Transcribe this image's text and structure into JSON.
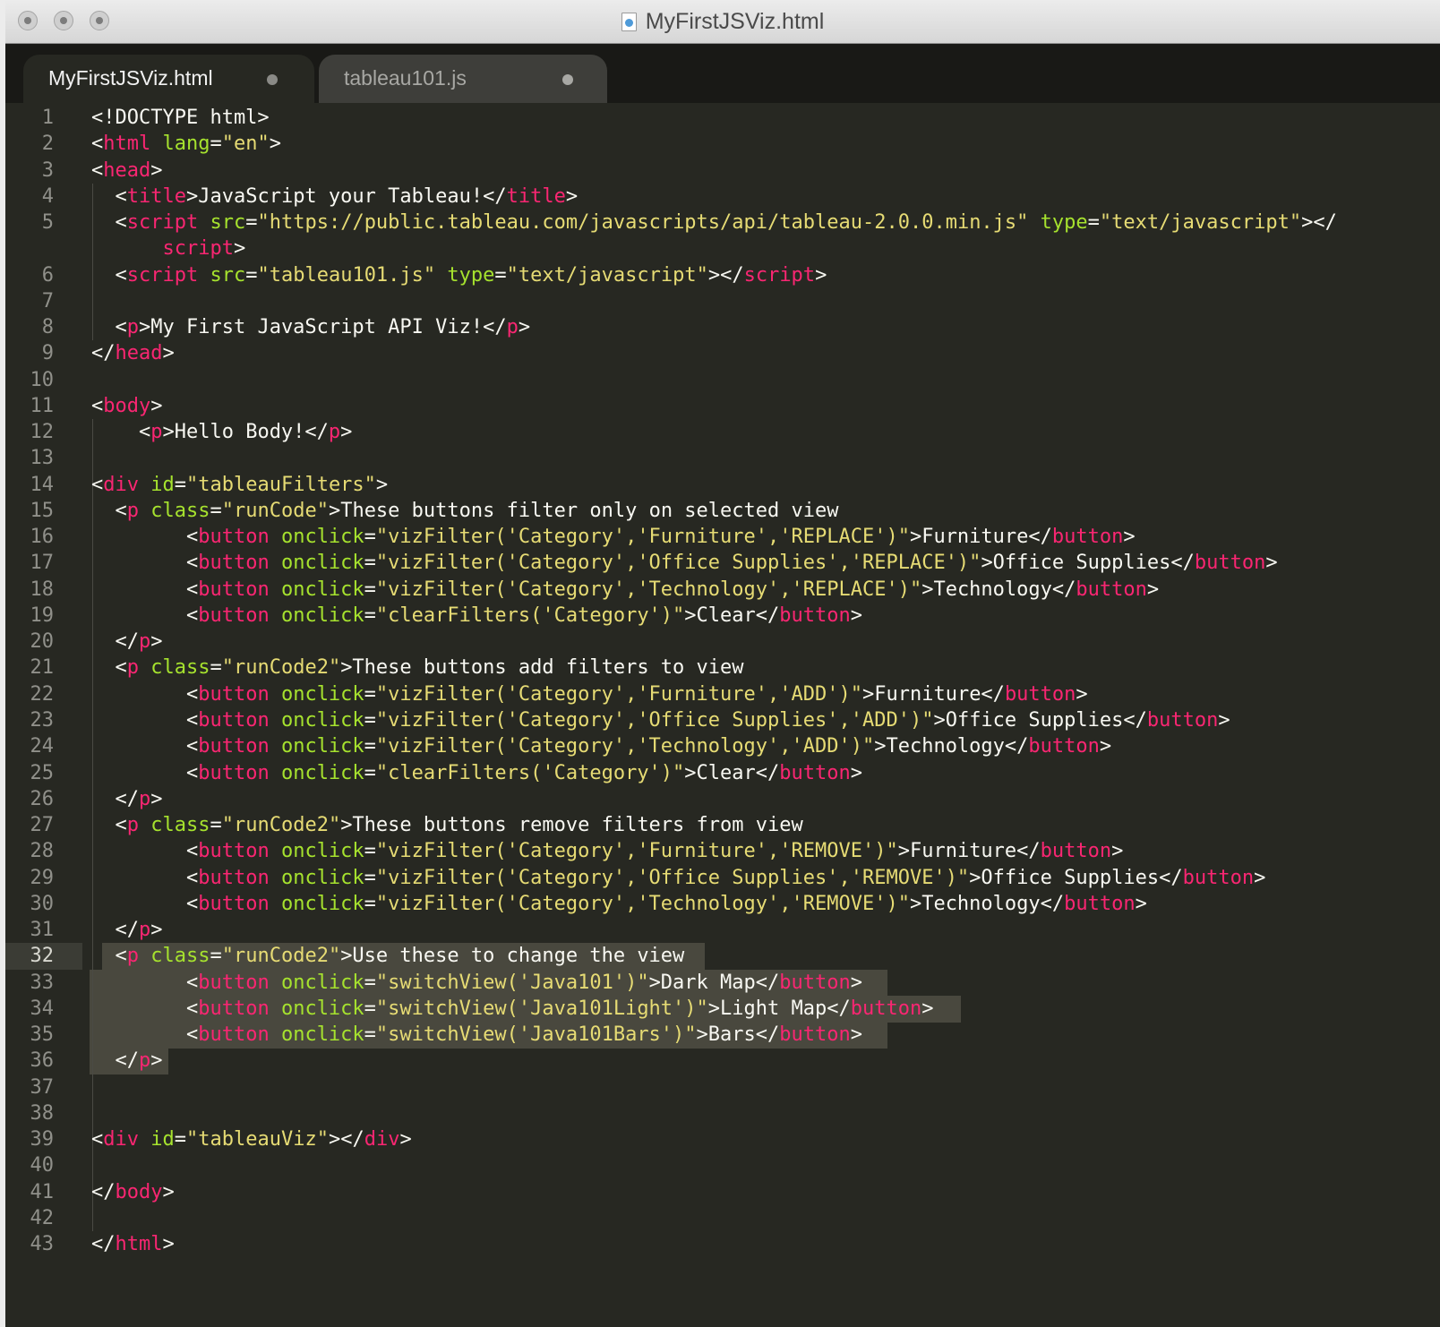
{
  "window": {
    "title": "MyFirstJSViz.html"
  },
  "tabs": [
    {
      "label": "MyFirstJSViz.html",
      "active": true
    },
    {
      "label": "tableau101.js",
      "active": false
    }
  ],
  "colors": {
    "background": "#272822",
    "tag": "#f92672",
    "attribute": "#a6e22e",
    "string": "#e6db74",
    "text": "#f8f8f2",
    "line_number": "#90908a"
  },
  "editor": {
    "current_line": 32,
    "lines": [
      {
        "n": "1",
        "tokens": [
          [
            "t",
            "<!DOCTYPE html>"
          ]
        ]
      },
      {
        "n": "2",
        "tokens": [
          [
            "t",
            "<"
          ],
          [
            "tg",
            "html"
          ],
          [
            "t",
            " "
          ],
          [
            "at",
            "lang"
          ],
          [
            "t",
            "="
          ],
          [
            "sv",
            "\"en\""
          ],
          [
            "t",
            ">"
          ]
        ]
      },
      {
        "n": "3",
        "tokens": [
          [
            "t",
            "<"
          ],
          [
            "tg",
            "head"
          ],
          [
            "t",
            ">"
          ]
        ]
      },
      {
        "n": "4",
        "tokens": [
          [
            "t",
            "  <"
          ],
          [
            "tg",
            "title"
          ],
          [
            "t",
            ">JavaScript your Tableau!</"
          ],
          [
            "tg",
            "title"
          ],
          [
            "t",
            ">"
          ]
        ]
      },
      {
        "n": "5",
        "tokens": [
          [
            "t",
            "  <"
          ],
          [
            "tg",
            "script"
          ],
          [
            "t",
            " "
          ],
          [
            "at",
            "src"
          ],
          [
            "t",
            "="
          ],
          [
            "sv",
            "\"https://public.tableau.com/javascripts/api/tableau-2.0.0.min.js\""
          ],
          [
            "t",
            " "
          ],
          [
            "at",
            "type"
          ],
          [
            "t",
            "="
          ],
          [
            "sv",
            "\"text/javascript\""
          ],
          [
            "t",
            "></"
          ]
        ]
      },
      {
        "n": "",
        "tokens": [
          [
            "t",
            "      "
          ],
          [
            "tg",
            "script"
          ],
          [
            "t",
            ">"
          ]
        ]
      },
      {
        "n": "6",
        "tokens": [
          [
            "t",
            "  <"
          ],
          [
            "tg",
            "script"
          ],
          [
            "t",
            " "
          ],
          [
            "at",
            "src"
          ],
          [
            "t",
            "="
          ],
          [
            "sv",
            "\"tableau101.js\""
          ],
          [
            "t",
            " "
          ],
          [
            "at",
            "type"
          ],
          [
            "t",
            "="
          ],
          [
            "sv",
            "\"text/javascript\""
          ],
          [
            "t",
            "></"
          ],
          [
            "tg",
            "script"
          ],
          [
            "t",
            ">"
          ]
        ]
      },
      {
        "n": "7",
        "tokens": []
      },
      {
        "n": "8",
        "tokens": [
          [
            "t",
            "  <"
          ],
          [
            "tg",
            "p"
          ],
          [
            "t",
            ">My First JavaScript API Viz!</"
          ],
          [
            "tg",
            "p"
          ],
          [
            "t",
            ">"
          ]
        ]
      },
      {
        "n": "9",
        "tokens": [
          [
            "t",
            "</"
          ],
          [
            "tg",
            "head"
          ],
          [
            "t",
            ">"
          ]
        ]
      },
      {
        "n": "10",
        "tokens": []
      },
      {
        "n": "11",
        "tokens": [
          [
            "t",
            "<"
          ],
          [
            "tg",
            "body"
          ],
          [
            "t",
            ">"
          ]
        ]
      },
      {
        "n": "12",
        "tokens": [
          [
            "t",
            "    <"
          ],
          [
            "tg",
            "p"
          ],
          [
            "t",
            ">Hello Body!</"
          ],
          [
            "tg",
            "p"
          ],
          [
            "t",
            ">"
          ]
        ]
      },
      {
        "n": "13",
        "tokens": []
      },
      {
        "n": "14",
        "tokens": [
          [
            "t",
            "<"
          ],
          [
            "tg",
            "div"
          ],
          [
            "t",
            " "
          ],
          [
            "at",
            "id"
          ],
          [
            "t",
            "="
          ],
          [
            "sv",
            "\"tableauFilters\""
          ],
          [
            "t",
            ">"
          ]
        ]
      },
      {
        "n": "15",
        "tokens": [
          [
            "t",
            "  <"
          ],
          [
            "tg",
            "p"
          ],
          [
            "t",
            " "
          ],
          [
            "at",
            "class"
          ],
          [
            "t",
            "="
          ],
          [
            "sv",
            "\"runCode\""
          ],
          [
            "t",
            ">These buttons filter only on selected view"
          ]
        ]
      },
      {
        "n": "16",
        "tokens": [
          [
            "t",
            "        <"
          ],
          [
            "tg",
            "button"
          ],
          [
            "t",
            " "
          ],
          [
            "at",
            "onclick"
          ],
          [
            "t",
            "="
          ],
          [
            "sv",
            "\"vizFilter('Category','Furniture','REPLACE')\""
          ],
          [
            "t",
            ">Furniture</"
          ],
          [
            "tg",
            "button"
          ],
          [
            "t",
            ">"
          ]
        ]
      },
      {
        "n": "17",
        "tokens": [
          [
            "t",
            "        <"
          ],
          [
            "tg",
            "button"
          ],
          [
            "t",
            " "
          ],
          [
            "at",
            "onclick"
          ],
          [
            "t",
            "="
          ],
          [
            "sv",
            "\"vizFilter('Category','Office Supplies','REPLACE')\""
          ],
          [
            "t",
            ">Office Supplies</"
          ],
          [
            "tg",
            "button"
          ],
          [
            "t",
            ">"
          ]
        ]
      },
      {
        "n": "18",
        "tokens": [
          [
            "t",
            "        <"
          ],
          [
            "tg",
            "button"
          ],
          [
            "t",
            " "
          ],
          [
            "at",
            "onclick"
          ],
          [
            "t",
            "="
          ],
          [
            "sv",
            "\"vizFilter('Category','Technology','REPLACE')\""
          ],
          [
            "t",
            ">Technology</"
          ],
          [
            "tg",
            "button"
          ],
          [
            "t",
            ">"
          ]
        ]
      },
      {
        "n": "19",
        "tokens": [
          [
            "t",
            "        <"
          ],
          [
            "tg",
            "button"
          ],
          [
            "t",
            " "
          ],
          [
            "at",
            "onclick"
          ],
          [
            "t",
            "="
          ],
          [
            "sv",
            "\"clearFilters('Category')\""
          ],
          [
            "t",
            ">Clear</"
          ],
          [
            "tg",
            "button"
          ],
          [
            "t",
            ">"
          ]
        ]
      },
      {
        "n": "20",
        "tokens": [
          [
            "t",
            "  </"
          ],
          [
            "tg",
            "p"
          ],
          [
            "t",
            ">"
          ]
        ]
      },
      {
        "n": "21",
        "tokens": [
          [
            "t",
            "  <"
          ],
          [
            "tg",
            "p"
          ],
          [
            "t",
            " "
          ],
          [
            "at",
            "class"
          ],
          [
            "t",
            "="
          ],
          [
            "sv",
            "\"runCode2\""
          ],
          [
            "t",
            ">These buttons add filters to view"
          ]
        ]
      },
      {
        "n": "22",
        "tokens": [
          [
            "t",
            "        <"
          ],
          [
            "tg",
            "button"
          ],
          [
            "t",
            " "
          ],
          [
            "at",
            "onclick"
          ],
          [
            "t",
            "="
          ],
          [
            "sv",
            "\"vizFilter('Category','Furniture','ADD')\""
          ],
          [
            "t",
            ">Furniture</"
          ],
          [
            "tg",
            "button"
          ],
          [
            "t",
            ">"
          ]
        ]
      },
      {
        "n": "23",
        "tokens": [
          [
            "t",
            "        <"
          ],
          [
            "tg",
            "button"
          ],
          [
            "t",
            " "
          ],
          [
            "at",
            "onclick"
          ],
          [
            "t",
            "="
          ],
          [
            "sv",
            "\"vizFilter('Category','Office Supplies','ADD')\""
          ],
          [
            "t",
            ">Office Supplies</"
          ],
          [
            "tg",
            "button"
          ],
          [
            "t",
            ">"
          ]
        ]
      },
      {
        "n": "24",
        "tokens": [
          [
            "t",
            "        <"
          ],
          [
            "tg",
            "button"
          ],
          [
            "t",
            " "
          ],
          [
            "at",
            "onclick"
          ],
          [
            "t",
            "="
          ],
          [
            "sv",
            "\"vizFilter('Category','Technology','ADD')\""
          ],
          [
            "t",
            ">Technology</"
          ],
          [
            "tg",
            "button"
          ],
          [
            "t",
            ">"
          ]
        ]
      },
      {
        "n": "25",
        "tokens": [
          [
            "t",
            "        <"
          ],
          [
            "tg",
            "button"
          ],
          [
            "t",
            " "
          ],
          [
            "at",
            "onclick"
          ],
          [
            "t",
            "="
          ],
          [
            "sv",
            "\"clearFilters('Category')\""
          ],
          [
            "t",
            ">Clear</"
          ],
          [
            "tg",
            "button"
          ],
          [
            "t",
            ">"
          ]
        ]
      },
      {
        "n": "26",
        "tokens": [
          [
            "t",
            "  </"
          ],
          [
            "tg",
            "p"
          ],
          [
            "t",
            ">"
          ]
        ]
      },
      {
        "n": "27",
        "tokens": [
          [
            "t",
            "  <"
          ],
          [
            "tg",
            "p"
          ],
          [
            "t",
            " "
          ],
          [
            "at",
            "class"
          ],
          [
            "t",
            "="
          ],
          [
            "sv",
            "\"runCode2\""
          ],
          [
            "t",
            ">These buttons remove filters from view"
          ]
        ]
      },
      {
        "n": "28",
        "tokens": [
          [
            "t",
            "        <"
          ],
          [
            "tg",
            "button"
          ],
          [
            "t",
            " "
          ],
          [
            "at",
            "onclick"
          ],
          [
            "t",
            "="
          ],
          [
            "sv",
            "\"vizFilter('Category','Furniture','REMOVE')\""
          ],
          [
            "t",
            ">Furniture</"
          ],
          [
            "tg",
            "button"
          ],
          [
            "t",
            ">"
          ]
        ]
      },
      {
        "n": "29",
        "tokens": [
          [
            "t",
            "        <"
          ],
          [
            "tg",
            "button"
          ],
          [
            "t",
            " "
          ],
          [
            "at",
            "onclick"
          ],
          [
            "t",
            "="
          ],
          [
            "sv",
            "\"vizFilter('Category','Office Supplies','REMOVE')\""
          ],
          [
            "t",
            ">Office Supplies</"
          ],
          [
            "tg",
            "button"
          ],
          [
            "t",
            ">"
          ]
        ]
      },
      {
        "n": "30",
        "tokens": [
          [
            "t",
            "        <"
          ],
          [
            "tg",
            "button"
          ],
          [
            "t",
            " "
          ],
          [
            "at",
            "onclick"
          ],
          [
            "t",
            "="
          ],
          [
            "sv",
            "\"vizFilter('Category','Technology','REMOVE')\""
          ],
          [
            "t",
            ">Technology</"
          ],
          [
            "tg",
            "button"
          ],
          [
            "t",
            ">"
          ]
        ]
      },
      {
        "n": "31",
        "tokens": [
          [
            "t",
            "  </"
          ],
          [
            "tg",
            "p"
          ],
          [
            "t",
            ">"
          ]
        ]
      },
      {
        "n": "32",
        "tokens": [
          [
            "t",
            "  <"
          ],
          [
            "tg",
            "p"
          ],
          [
            "t",
            " "
          ],
          [
            "at",
            "class"
          ],
          [
            "t",
            "="
          ],
          [
            "sv",
            "\"runCode2\""
          ],
          [
            "t",
            ">Use these to change the view"
          ]
        ]
      },
      {
        "n": "33",
        "tokens": [
          [
            "t",
            "        <"
          ],
          [
            "tg",
            "button"
          ],
          [
            "t",
            " "
          ],
          [
            "at",
            "onclick"
          ],
          [
            "t",
            "="
          ],
          [
            "sv",
            "\"switchView('Java101')\""
          ],
          [
            "t",
            ">Dark Map</"
          ],
          [
            "tg",
            "button"
          ],
          [
            "t",
            ">"
          ]
        ]
      },
      {
        "n": "34",
        "tokens": [
          [
            "t",
            "        <"
          ],
          [
            "tg",
            "button"
          ],
          [
            "t",
            " "
          ],
          [
            "at",
            "onclick"
          ],
          [
            "t",
            "="
          ],
          [
            "sv",
            "\"switchView('Java101Light')\""
          ],
          [
            "t",
            ">Light Map</"
          ],
          [
            "tg",
            "button"
          ],
          [
            "t",
            ">"
          ]
        ]
      },
      {
        "n": "35",
        "tokens": [
          [
            "t",
            "        <"
          ],
          [
            "tg",
            "button"
          ],
          [
            "t",
            " "
          ],
          [
            "at",
            "onclick"
          ],
          [
            "t",
            "="
          ],
          [
            "sv",
            "\"switchView('Java101Bars')\""
          ],
          [
            "t",
            ">Bars</"
          ],
          [
            "tg",
            "button"
          ],
          [
            "t",
            ">"
          ]
        ]
      },
      {
        "n": "36",
        "tokens": [
          [
            "t",
            "  </"
          ],
          [
            "tg",
            "p"
          ],
          [
            "t",
            ">"
          ]
        ]
      },
      {
        "n": "37",
        "tokens": []
      },
      {
        "n": "38",
        "tokens": []
      },
      {
        "n": "39",
        "tokens": [
          [
            "t",
            "<"
          ],
          [
            "tg",
            "div"
          ],
          [
            "t",
            " "
          ],
          [
            "at",
            "id"
          ],
          [
            "t",
            "="
          ],
          [
            "sv",
            "\"tableauViz\""
          ],
          [
            "t",
            "></"
          ],
          [
            "tg",
            "div"
          ],
          [
            "t",
            ">"
          ]
        ]
      },
      {
        "n": "40",
        "tokens": []
      },
      {
        "n": "41",
        "tokens": [
          [
            "t",
            "</"
          ],
          [
            "tg",
            "body"
          ],
          [
            "t",
            ">"
          ]
        ]
      },
      {
        "n": "42",
        "tokens": []
      },
      {
        "n": "43",
        "tokens": [
          [
            "t",
            "</"
          ],
          [
            "tg",
            "html"
          ],
          [
            "t",
            ">"
          ]
        ]
      }
    ]
  }
}
